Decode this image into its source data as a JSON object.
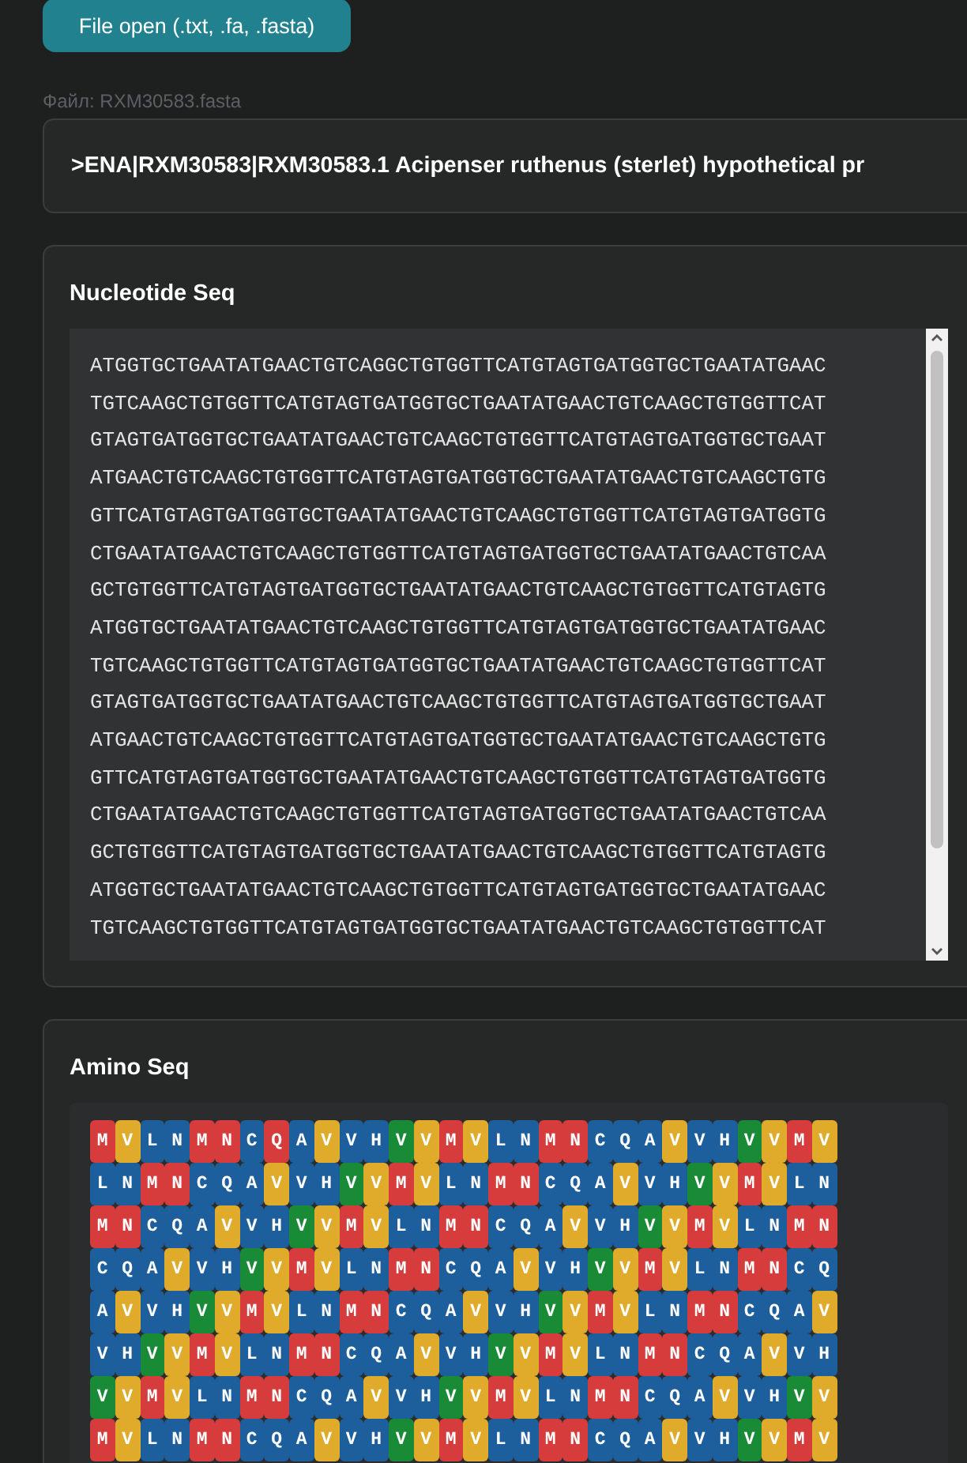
{
  "open_button": {
    "label": "File open (.txt, .fa, .fasta)"
  },
  "file_label": "Файл: RXM30583.fasta",
  "header": {
    "text": ">ENA|RXM30583|RXM30583.1 Acipenser ruthenus (sterlet) hypothetical pr"
  },
  "nucleotide": {
    "title": "Nucleotide Seq",
    "lines": [
      "ATGGTGCTGAATATGAACTGTCAGGCTGTGGTTCATGTAGTGATGGTGCTGAATATGAAC",
      "TGTCAAGCTGTGGTTCATGTAGTGATGGTGCTGAATATGAACTGTCAAGCTGTGGTTCAT",
      "GTAGTGATGGTGCTGAATATGAACTGTCAAGCTGTGGTTCATGTAGTGATGGTGCTGAAT",
      "ATGAACTGTCAAGCTGTGGTTCATGTAGTGATGGTGCTGAATATGAACTGTCAAGCTGTG",
      "GTTCATGTAGTGATGGTGCTGAATATGAACTGTCAAGCTGTGGTTCATGTAGTGATGGTG",
      "CTGAATATGAACTGTCAAGCTGTGGTTCATGTAGTGATGGTGCTGAATATGAACTGTCAA",
      "GCTGTGGTTCATGTAGTGATGGTGCTGAATATGAACTGTCAAGCTGTGGTTCATGTAGTG",
      "ATGGTGCTGAATATGAACTGTCAAGCTGTGGTTCATGTAGTGATGGTGCTGAATATGAAC",
      "TGTCAAGCTGTGGTTCATGTAGTGATGGTGCTGAATATGAACTGTCAAGCTGTGGTTCAT",
      "GTAGTGATGGTGCTGAATATGAACTGTCAAGCTGTGGTTCATGTAGTGATGGTGCTGAAT",
      "ATGAACTGTCAAGCTGTGGTTCATGTAGTGATGGTGCTGAATATGAACTGTCAAGCTGTG",
      "GTTCATGTAGTGATGGTGCTGAATATGAACTGTCAAGCTGTGGTTCATGTAGTGATGGTG",
      "CTGAATATGAACTGTCAAGCTGTGGTTCATGTAGTGATGGTGCTGAATATGAACTGTCAA",
      "GCTGTGGTTCATGTAGTGATGGTGCTGAATATGAACTGTCAAGCTGTGGTTCATGTAGTG",
      "ATGGTGCTGAATATGAACTGTCAAGCTGTGGTTCATGTAGTGATGGTGCTGAATATGAAC",
      "TGTCAAGCTGTGGTTCATGTAGTGATGGTGCTGAATATGAACTGTCAAGCTGTGGTTCAT"
    ]
  },
  "amino": {
    "title": "Amino Seq",
    "rows": [
      [
        {
          "aa": "M",
          "color": "#d63c3c"
        },
        {
          "aa": "V",
          "color": "#e0ab2a"
        },
        {
          "aa": "L",
          "color": "#1d5e9c"
        },
        {
          "aa": "N",
          "color": "#1d5e9c"
        },
        {
          "aa": "M",
          "color": "#d63c3c"
        },
        {
          "aa": "N",
          "color": "#d63c3c"
        },
        {
          "aa": "C",
          "color": "#1d5e9c"
        },
        {
          "aa": "Q",
          "color": "#d63c3c"
        },
        {
          "aa": "A",
          "color": "#1d5e9c"
        },
        {
          "aa": "V",
          "color": "#e0ab2a"
        },
        {
          "aa": "V",
          "color": "#1d5e9c"
        },
        {
          "aa": "H",
          "color": "#1d5e9c"
        },
        {
          "aa": "V",
          "color": "#198a35"
        },
        {
          "aa": "V",
          "color": "#e0ab2a"
        },
        {
          "aa": "M",
          "color": "#d63c3c"
        },
        {
          "aa": "V",
          "color": "#e0ab2a"
        },
        {
          "aa": "L",
          "color": "#1d5e9c"
        },
        {
          "aa": "N",
          "color": "#1d5e9c"
        },
        {
          "aa": "M",
          "color": "#d63c3c"
        },
        {
          "aa": "N",
          "color": "#d63c3c"
        },
        {
          "aa": "C",
          "color": "#1d5e9c"
        },
        {
          "aa": "Q",
          "color": "#1d5e9c"
        },
        {
          "aa": "A",
          "color": "#1d5e9c"
        },
        {
          "aa": "V",
          "color": "#e0ab2a"
        },
        {
          "aa": "V",
          "color": "#1d5e9c"
        },
        {
          "aa": "H",
          "color": "#1d5e9c"
        },
        {
          "aa": "V",
          "color": "#198a35"
        },
        {
          "aa": "V",
          "color": "#e0ab2a"
        },
        {
          "aa": "M",
          "color": "#d63c3c"
        },
        {
          "aa": "V",
          "color": "#e0ab2a"
        }
      ],
      [
        {
          "aa": "L",
          "color": "#1d5e9c"
        },
        {
          "aa": "N",
          "color": "#1d5e9c"
        },
        {
          "aa": "M",
          "color": "#d63c3c"
        },
        {
          "aa": "N",
          "color": "#d63c3c"
        },
        {
          "aa": "C",
          "color": "#1d5e9c"
        },
        {
          "aa": "Q",
          "color": "#1d5e9c"
        },
        {
          "aa": "A",
          "color": "#1d5e9c"
        },
        {
          "aa": "V",
          "color": "#e0ab2a"
        },
        {
          "aa": "V",
          "color": "#1d5e9c"
        },
        {
          "aa": "H",
          "color": "#1d5e9c"
        },
        {
          "aa": "V",
          "color": "#198a35"
        },
        {
          "aa": "V",
          "color": "#e0ab2a"
        },
        {
          "aa": "M",
          "color": "#d63c3c"
        },
        {
          "aa": "V",
          "color": "#e0ab2a"
        },
        {
          "aa": "L",
          "color": "#1d5e9c"
        },
        {
          "aa": "N",
          "color": "#1d5e9c"
        },
        {
          "aa": "M",
          "color": "#d63c3c"
        },
        {
          "aa": "N",
          "color": "#d63c3c"
        },
        {
          "aa": "C",
          "color": "#1d5e9c"
        },
        {
          "aa": "Q",
          "color": "#1d5e9c"
        },
        {
          "aa": "A",
          "color": "#1d5e9c"
        },
        {
          "aa": "V",
          "color": "#e0ab2a"
        },
        {
          "aa": "V",
          "color": "#1d5e9c"
        },
        {
          "aa": "H",
          "color": "#1d5e9c"
        },
        {
          "aa": "V",
          "color": "#198a35"
        },
        {
          "aa": "V",
          "color": "#e0ab2a"
        },
        {
          "aa": "M",
          "color": "#d63c3c"
        },
        {
          "aa": "V",
          "color": "#e0ab2a"
        },
        {
          "aa": "L",
          "color": "#1d5e9c"
        },
        {
          "aa": "N",
          "color": "#1d5e9c"
        }
      ],
      [
        {
          "aa": "M",
          "color": "#d63c3c"
        },
        {
          "aa": "N",
          "color": "#d63c3c"
        },
        {
          "aa": "C",
          "color": "#1d5e9c"
        },
        {
          "aa": "Q",
          "color": "#1d5e9c"
        },
        {
          "aa": "A",
          "color": "#1d5e9c"
        },
        {
          "aa": "V",
          "color": "#e0ab2a"
        },
        {
          "aa": "V",
          "color": "#1d5e9c"
        },
        {
          "aa": "H",
          "color": "#1d5e9c"
        },
        {
          "aa": "V",
          "color": "#198a35"
        },
        {
          "aa": "V",
          "color": "#e0ab2a"
        },
        {
          "aa": "M",
          "color": "#d63c3c"
        },
        {
          "aa": "V",
          "color": "#e0ab2a"
        },
        {
          "aa": "L",
          "color": "#1d5e9c"
        },
        {
          "aa": "N",
          "color": "#1d5e9c"
        },
        {
          "aa": "M",
          "color": "#d63c3c"
        },
        {
          "aa": "N",
          "color": "#d63c3c"
        },
        {
          "aa": "C",
          "color": "#1d5e9c"
        },
        {
          "aa": "Q",
          "color": "#1d5e9c"
        },
        {
          "aa": "A",
          "color": "#1d5e9c"
        },
        {
          "aa": "V",
          "color": "#e0ab2a"
        },
        {
          "aa": "V",
          "color": "#1d5e9c"
        },
        {
          "aa": "H",
          "color": "#1d5e9c"
        },
        {
          "aa": "V",
          "color": "#198a35"
        },
        {
          "aa": "V",
          "color": "#e0ab2a"
        },
        {
          "aa": "M",
          "color": "#d63c3c"
        },
        {
          "aa": "V",
          "color": "#e0ab2a"
        },
        {
          "aa": "L",
          "color": "#1d5e9c"
        },
        {
          "aa": "N",
          "color": "#1d5e9c"
        },
        {
          "aa": "M",
          "color": "#d63c3c"
        },
        {
          "aa": "N",
          "color": "#d63c3c"
        }
      ],
      [
        {
          "aa": "C",
          "color": "#1d5e9c"
        },
        {
          "aa": "Q",
          "color": "#1d5e9c"
        },
        {
          "aa": "A",
          "color": "#1d5e9c"
        },
        {
          "aa": "V",
          "color": "#e0ab2a"
        },
        {
          "aa": "V",
          "color": "#1d5e9c"
        },
        {
          "aa": "H",
          "color": "#1d5e9c"
        },
        {
          "aa": "V",
          "color": "#198a35"
        },
        {
          "aa": "V",
          "color": "#e0ab2a"
        },
        {
          "aa": "M",
          "color": "#d63c3c"
        },
        {
          "aa": "V",
          "color": "#e0ab2a"
        },
        {
          "aa": "L",
          "color": "#1d5e9c"
        },
        {
          "aa": "N",
          "color": "#1d5e9c"
        },
        {
          "aa": "M",
          "color": "#d63c3c"
        },
        {
          "aa": "N",
          "color": "#d63c3c"
        },
        {
          "aa": "C",
          "color": "#1d5e9c"
        },
        {
          "aa": "Q",
          "color": "#1d5e9c"
        },
        {
          "aa": "A",
          "color": "#1d5e9c"
        },
        {
          "aa": "V",
          "color": "#e0ab2a"
        },
        {
          "aa": "V",
          "color": "#1d5e9c"
        },
        {
          "aa": "H",
          "color": "#1d5e9c"
        },
        {
          "aa": "V",
          "color": "#198a35"
        },
        {
          "aa": "V",
          "color": "#e0ab2a"
        },
        {
          "aa": "M",
          "color": "#d63c3c"
        },
        {
          "aa": "V",
          "color": "#e0ab2a"
        },
        {
          "aa": "L",
          "color": "#1d5e9c"
        },
        {
          "aa": "N",
          "color": "#1d5e9c"
        },
        {
          "aa": "M",
          "color": "#d63c3c"
        },
        {
          "aa": "N",
          "color": "#d63c3c"
        },
        {
          "aa": "C",
          "color": "#1d5e9c"
        },
        {
          "aa": "Q",
          "color": "#1d5e9c"
        }
      ],
      [
        {
          "aa": "A",
          "color": "#1d5e9c"
        },
        {
          "aa": "V",
          "color": "#e0ab2a"
        },
        {
          "aa": "V",
          "color": "#1d5e9c"
        },
        {
          "aa": "H",
          "color": "#1d5e9c"
        },
        {
          "aa": "V",
          "color": "#198a35"
        },
        {
          "aa": "V",
          "color": "#e0ab2a"
        },
        {
          "aa": "M",
          "color": "#d63c3c"
        },
        {
          "aa": "V",
          "color": "#e0ab2a"
        },
        {
          "aa": "L",
          "color": "#1d5e9c"
        },
        {
          "aa": "N",
          "color": "#1d5e9c"
        },
        {
          "aa": "M",
          "color": "#d63c3c"
        },
        {
          "aa": "N",
          "color": "#d63c3c"
        },
        {
          "aa": "C",
          "color": "#1d5e9c"
        },
        {
          "aa": "Q",
          "color": "#1d5e9c"
        },
        {
          "aa": "A",
          "color": "#1d5e9c"
        },
        {
          "aa": "V",
          "color": "#e0ab2a"
        },
        {
          "aa": "V",
          "color": "#1d5e9c"
        },
        {
          "aa": "H",
          "color": "#1d5e9c"
        },
        {
          "aa": "V",
          "color": "#198a35"
        },
        {
          "aa": "V",
          "color": "#e0ab2a"
        },
        {
          "aa": "M",
          "color": "#d63c3c"
        },
        {
          "aa": "V",
          "color": "#e0ab2a"
        },
        {
          "aa": "L",
          "color": "#1d5e9c"
        },
        {
          "aa": "N",
          "color": "#1d5e9c"
        },
        {
          "aa": "M",
          "color": "#d63c3c"
        },
        {
          "aa": "N",
          "color": "#d63c3c"
        },
        {
          "aa": "C",
          "color": "#1d5e9c"
        },
        {
          "aa": "Q",
          "color": "#1d5e9c"
        },
        {
          "aa": "A",
          "color": "#1d5e9c"
        },
        {
          "aa": "V",
          "color": "#e0ab2a"
        }
      ],
      [
        {
          "aa": "V",
          "color": "#1d5e9c"
        },
        {
          "aa": "H",
          "color": "#1d5e9c"
        },
        {
          "aa": "V",
          "color": "#198a35"
        },
        {
          "aa": "V",
          "color": "#e0ab2a"
        },
        {
          "aa": "M",
          "color": "#d63c3c"
        },
        {
          "aa": "V",
          "color": "#e0ab2a"
        },
        {
          "aa": "L",
          "color": "#1d5e9c"
        },
        {
          "aa": "N",
          "color": "#1d5e9c"
        },
        {
          "aa": "M",
          "color": "#d63c3c"
        },
        {
          "aa": "N",
          "color": "#d63c3c"
        },
        {
          "aa": "C",
          "color": "#1d5e9c"
        },
        {
          "aa": "Q",
          "color": "#1d5e9c"
        },
        {
          "aa": "A",
          "color": "#1d5e9c"
        },
        {
          "aa": "V",
          "color": "#e0ab2a"
        },
        {
          "aa": "V",
          "color": "#1d5e9c"
        },
        {
          "aa": "H",
          "color": "#1d5e9c"
        },
        {
          "aa": "V",
          "color": "#198a35"
        },
        {
          "aa": "V",
          "color": "#e0ab2a"
        },
        {
          "aa": "M",
          "color": "#d63c3c"
        },
        {
          "aa": "V",
          "color": "#e0ab2a"
        },
        {
          "aa": "L",
          "color": "#1d5e9c"
        },
        {
          "aa": "N",
          "color": "#1d5e9c"
        },
        {
          "aa": "M",
          "color": "#d63c3c"
        },
        {
          "aa": "N",
          "color": "#d63c3c"
        },
        {
          "aa": "C",
          "color": "#1d5e9c"
        },
        {
          "aa": "Q",
          "color": "#1d5e9c"
        },
        {
          "aa": "A",
          "color": "#1d5e9c"
        },
        {
          "aa": "V",
          "color": "#e0ab2a"
        },
        {
          "aa": "V",
          "color": "#1d5e9c"
        },
        {
          "aa": "H",
          "color": "#1d5e9c"
        }
      ],
      [
        {
          "aa": "V",
          "color": "#198a35"
        },
        {
          "aa": "V",
          "color": "#e0ab2a"
        },
        {
          "aa": "M",
          "color": "#d63c3c"
        },
        {
          "aa": "V",
          "color": "#e0ab2a"
        },
        {
          "aa": "L",
          "color": "#1d5e9c"
        },
        {
          "aa": "N",
          "color": "#1d5e9c"
        },
        {
          "aa": "M",
          "color": "#d63c3c"
        },
        {
          "aa": "N",
          "color": "#d63c3c"
        },
        {
          "aa": "C",
          "color": "#1d5e9c"
        },
        {
          "aa": "Q",
          "color": "#1d5e9c"
        },
        {
          "aa": "A",
          "color": "#1d5e9c"
        },
        {
          "aa": "V",
          "color": "#e0ab2a"
        },
        {
          "aa": "V",
          "color": "#1d5e9c"
        },
        {
          "aa": "H",
          "color": "#1d5e9c"
        },
        {
          "aa": "V",
          "color": "#198a35"
        },
        {
          "aa": "V",
          "color": "#e0ab2a"
        },
        {
          "aa": "M",
          "color": "#d63c3c"
        },
        {
          "aa": "V",
          "color": "#e0ab2a"
        },
        {
          "aa": "L",
          "color": "#1d5e9c"
        },
        {
          "aa": "N",
          "color": "#1d5e9c"
        },
        {
          "aa": "M",
          "color": "#d63c3c"
        },
        {
          "aa": "N",
          "color": "#d63c3c"
        },
        {
          "aa": "C",
          "color": "#1d5e9c"
        },
        {
          "aa": "Q",
          "color": "#1d5e9c"
        },
        {
          "aa": "A",
          "color": "#1d5e9c"
        },
        {
          "aa": "V",
          "color": "#e0ab2a"
        },
        {
          "aa": "V",
          "color": "#1d5e9c"
        },
        {
          "aa": "H",
          "color": "#1d5e9c"
        },
        {
          "aa": "V",
          "color": "#198a35"
        },
        {
          "aa": "V",
          "color": "#e0ab2a"
        }
      ],
      [
        {
          "aa": "M",
          "color": "#d63c3c"
        },
        {
          "aa": "V",
          "color": "#e0ab2a"
        },
        {
          "aa": "L",
          "color": "#1d5e9c"
        },
        {
          "aa": "N",
          "color": "#1d5e9c"
        },
        {
          "aa": "M",
          "color": "#d63c3c"
        },
        {
          "aa": "N",
          "color": "#d63c3c"
        },
        {
          "aa": "C",
          "color": "#1d5e9c"
        },
        {
          "aa": "Q",
          "color": "#1d5e9c"
        },
        {
          "aa": "A",
          "color": "#1d5e9c"
        },
        {
          "aa": "V",
          "color": "#e0ab2a"
        },
        {
          "aa": "V",
          "color": "#1d5e9c"
        },
        {
          "aa": "H",
          "color": "#1d5e9c"
        },
        {
          "aa": "V",
          "color": "#198a35"
        },
        {
          "aa": "V",
          "color": "#e0ab2a"
        },
        {
          "aa": "M",
          "color": "#d63c3c"
        },
        {
          "aa": "V",
          "color": "#e0ab2a"
        },
        {
          "aa": "L",
          "color": "#1d5e9c"
        },
        {
          "aa": "N",
          "color": "#1d5e9c"
        },
        {
          "aa": "M",
          "color": "#d63c3c"
        },
        {
          "aa": "N",
          "color": "#d63c3c"
        },
        {
          "aa": "C",
          "color": "#1d5e9c"
        },
        {
          "aa": "Q",
          "color": "#1d5e9c"
        },
        {
          "aa": "A",
          "color": "#1d5e9c"
        },
        {
          "aa": "V",
          "color": "#e0ab2a"
        },
        {
          "aa": "V",
          "color": "#1d5e9c"
        },
        {
          "aa": "H",
          "color": "#1d5e9c"
        },
        {
          "aa": "V",
          "color": "#198a35"
        },
        {
          "aa": "V",
          "color": "#e0ab2a"
        },
        {
          "aa": "M",
          "color": "#d63c3c"
        },
        {
          "aa": "V",
          "color": "#e0ab2a"
        }
      ]
    ]
  }
}
